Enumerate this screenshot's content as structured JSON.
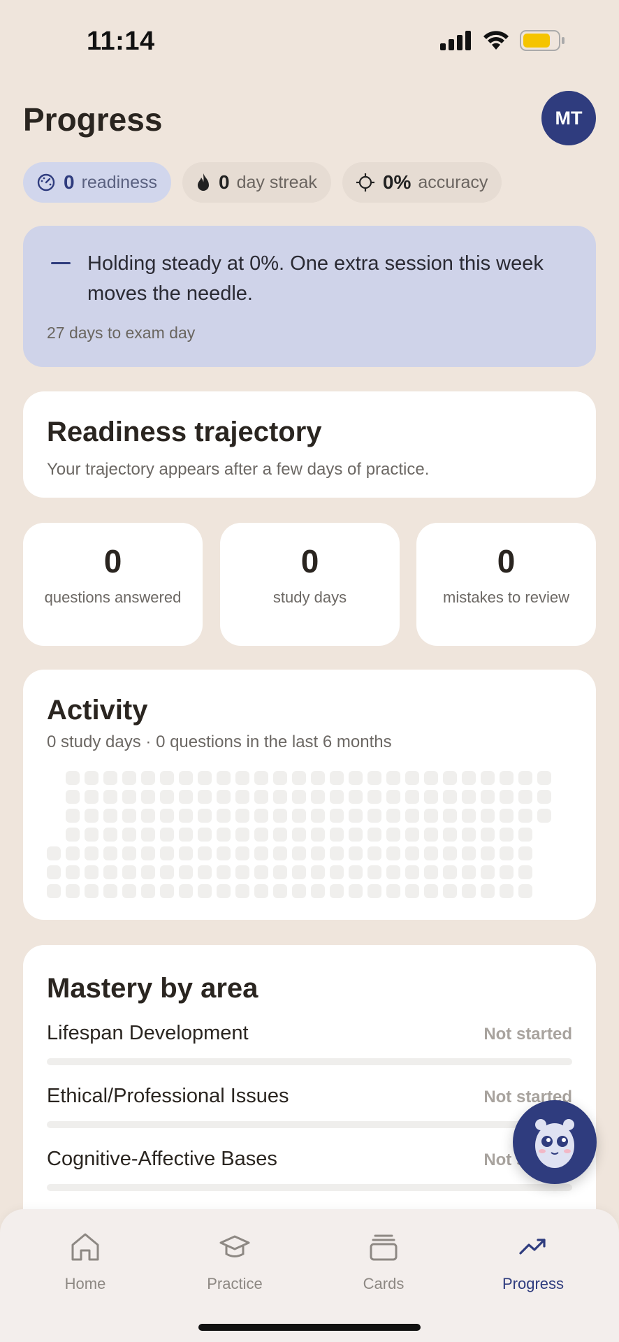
{
  "status_bar": {
    "time": "11:14"
  },
  "header": {
    "title": "Progress",
    "avatar_initials": "MT"
  },
  "chips": [
    {
      "value": "0",
      "label": "readiness",
      "icon": "gauge-icon"
    },
    {
      "value": "0",
      "label": "day streak",
      "icon": "flame-icon"
    },
    {
      "value": "0%",
      "label": "accuracy",
      "icon": "crosshair-icon"
    }
  ],
  "banner": {
    "message": "Holding steady at 0%. One extra session this week moves the needle.",
    "subtext": "27 days to exam day"
  },
  "trajectory": {
    "title": "Readiness trajectory",
    "subtitle": "Your trajectory appears after a few days of practice."
  },
  "stats": [
    {
      "value": "0",
      "label": "questions answered"
    },
    {
      "value": "0",
      "label": "study days"
    },
    {
      "value": "0",
      "label": "mistakes to review"
    }
  ],
  "activity": {
    "title": "Activity",
    "subtitle": "0 study days · 0 questions in the last 6 months"
  },
  "mastery": {
    "title": "Mastery by area",
    "areas": [
      {
        "name": "Lifespan Development",
        "status": "Not started",
        "progress": 0
      },
      {
        "name": "Ethical/Professional Issues",
        "status": "Not started",
        "progress": 0
      },
      {
        "name": "Cognitive-Affective Bases",
        "status": "Not started",
        "progress": 0
      }
    ]
  },
  "tabs": [
    {
      "label": "Home",
      "icon": "home-icon"
    },
    {
      "label": "Practice",
      "icon": "graduation-cap-icon"
    },
    {
      "label": "Cards",
      "icon": "cards-icon"
    },
    {
      "label": "Progress",
      "icon": "trend-up-icon",
      "active": true
    }
  ],
  "colors": {
    "accent": "#2f3c7e",
    "background": "#efe5dc",
    "banner": "#cfd3e9"
  }
}
